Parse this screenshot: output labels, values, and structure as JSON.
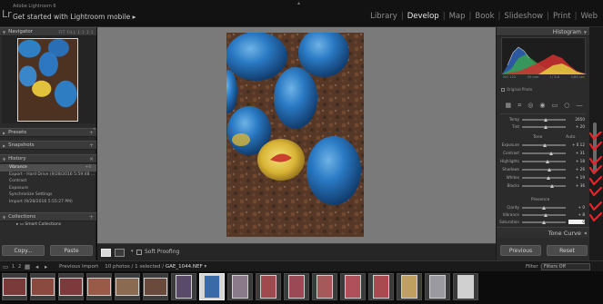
{
  "app": {
    "name": "Adobe Lightroom 6",
    "mobile_link": "Get started with Lightroom mobile",
    "modules": [
      "Library",
      "Develop",
      "Map",
      "Book",
      "Slideshow",
      "Print",
      "Web"
    ],
    "active_module": "Develop"
  },
  "left_panel": {
    "navigator": {
      "title": "Navigator",
      "zoom_options": "FIT  FILL  1:1  3:1"
    },
    "presets": {
      "title": "Presets"
    },
    "snapshots": {
      "title": "Snapshots"
    },
    "history": {
      "title": "History",
      "items": [
        {
          "label": "Vibrance",
          "from": "+4",
          "to": "",
          "selected": true
        },
        {
          "label": "Export - Hard Drive (9/28/2016 5:59:48 ...",
          "from": "",
          "to": "",
          "selected": false
        },
        {
          "label": "Contrast",
          "from": "",
          "to": "",
          "selected": false
        },
        {
          "label": "Exposure",
          "from": "",
          "to": "",
          "selected": false
        },
        {
          "label": "Synchronize Settings",
          "from": "",
          "to": "",
          "selected": false
        },
        {
          "label": "Import (9/28/2016 5:55:27 PM)",
          "from": "",
          "to": "",
          "selected": false
        }
      ]
    },
    "collections": {
      "title": "Collections",
      "smart_collections": "Smart Collections"
    },
    "copy_label": "Copy...",
    "paste_label": "Paste"
  },
  "toolbar": {
    "soft_proofing": "Soft Proofing"
  },
  "right_panel": {
    "histogram": {
      "title": "Histogram",
      "stats": [
        "ISO 125",
        "50 mm",
        "f / 5.6",
        "1/60 sec"
      ],
      "original_photo": "Original Photo"
    },
    "white_balance": {
      "temp_label": "Temp",
      "temp_value": "2650",
      "temp_level": 0.55,
      "tint_label": "Tint",
      "tint_value": "+ 20",
      "tint_level": 0.55
    },
    "tone": {
      "title": "Tone",
      "auto_label": "Auto",
      "sliders": [
        {
          "label": "Exposure",
          "value": "+ 0.12",
          "level": 0.52
        },
        {
          "label": "Contrast",
          "value": "+ 31",
          "level": 0.66
        },
        {
          "label": "Highlights",
          "value": "+ 18",
          "level": 0.59
        },
        {
          "label": "Shadows",
          "value": "+ 26",
          "level": 0.63
        },
        {
          "label": "Whites",
          "value": "+ 19",
          "level": 0.6
        },
        {
          "label": "Blacks",
          "value": "+ 36",
          "level": 0.68
        }
      ]
    },
    "presence": {
      "title": "Presence",
      "sliders": [
        {
          "label": "Clarity",
          "value": "+ 0",
          "level": 0.5
        },
        {
          "label": "Vibrance",
          "value": "+ 8",
          "level": 0.54
        },
        {
          "label": "Saturation",
          "value": "0",
          "level": 0.5
        }
      ]
    },
    "tone_curve": "Tone Curve",
    "previous_label": "Previous",
    "reset_label": "Reset"
  },
  "filmstrip": {
    "page_labels": [
      "1",
      "2"
    ],
    "source_label": "Previous Import",
    "count_text": "10 photos / 1 selected /",
    "filename": "GAE_1044.NEF",
    "filter_label": "Filter :",
    "filter_value": "Filters Off"
  },
  "colors": {
    "red_annotation": "#e3262a",
    "panel_bg": "#2b2b2b",
    "canvas_bg": "#7a7a7a"
  }
}
